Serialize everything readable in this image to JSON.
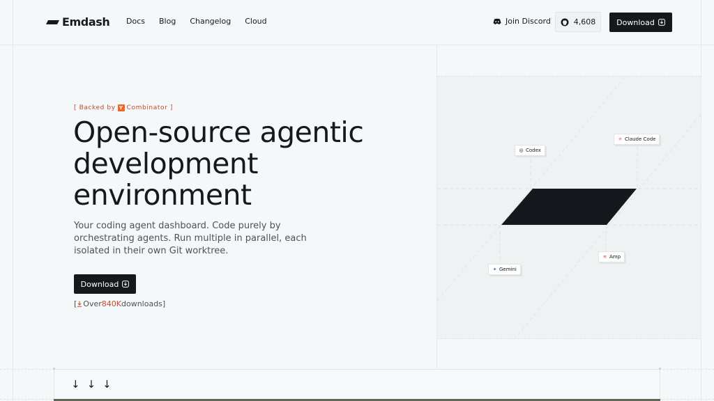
{
  "header": {
    "logo_text": "Emdash",
    "nav": [
      "Docs",
      "Blog",
      "Changelog",
      "Cloud"
    ],
    "discord_label": "Join Discord",
    "stars": "4,608",
    "download_label": "Download"
  },
  "hero": {
    "badge_prefix": "[ Backed by",
    "badge_yc": "Y",
    "badge_suffix": "Combinator ]",
    "title": "Open-source agentic development environment",
    "subtitle": "Your coding agent dashboard. Code purely by orchestrating agents. Run multiple in parallel, each isolated in their own Git worktree.",
    "download_label": "Download",
    "note_prefix": "[",
    "note_over": "Over ",
    "note_count": "840K",
    "note_suffix": " downloads]"
  },
  "illustration": {
    "agents": [
      "Codex",
      "Claude Code",
      "Gemini",
      "Amp"
    ]
  },
  "bottom": {
    "arrows": [
      "↓",
      "↓",
      "↓"
    ]
  },
  "colors": {
    "background": "#f4f8f8",
    "ink": "#15191d",
    "accent": "#c44a2c",
    "yc_orange": "#f26522"
  },
  "icons": {
    "discord": "discord-icon",
    "github": "github-icon",
    "download": "download-icon"
  }
}
